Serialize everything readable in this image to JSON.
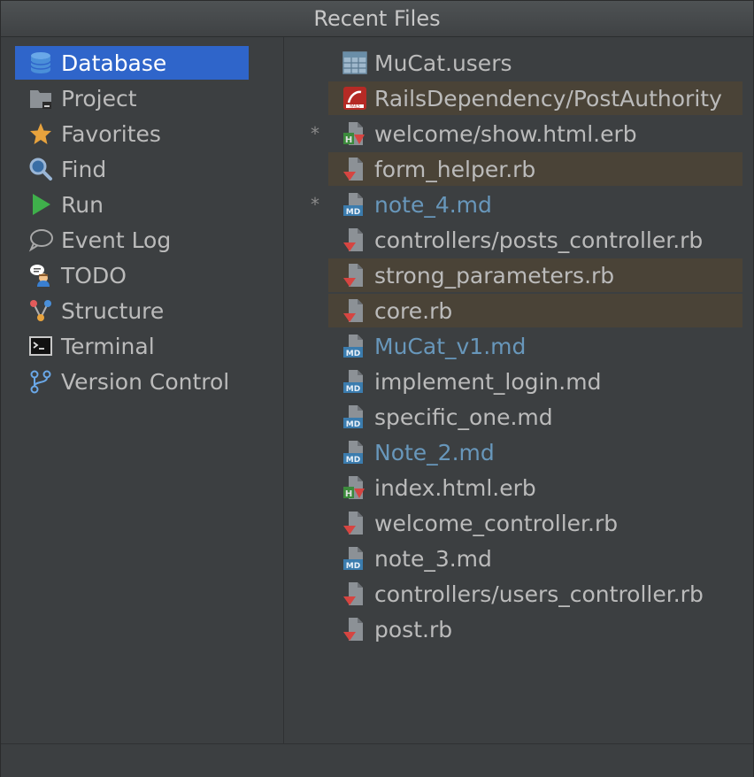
{
  "window": {
    "title": "Recent Files"
  },
  "tool_windows": [
    {
      "label": "Database",
      "icon": "database-icon",
      "selected": true
    },
    {
      "label": "Project",
      "icon": "project-folder-icon"
    },
    {
      "label": "Favorites",
      "icon": "star-icon"
    },
    {
      "label": "Find",
      "icon": "magnifier-icon"
    },
    {
      "label": "Run",
      "icon": "run-icon"
    },
    {
      "label": "Event Log",
      "icon": "speech-bubble-icon"
    },
    {
      "label": "TODO",
      "icon": "todo-icon"
    },
    {
      "label": "Structure",
      "icon": "structure-icon"
    },
    {
      "label": "Terminal",
      "icon": "terminal-icon"
    },
    {
      "label": "Version Control",
      "icon": "version-control-icon"
    }
  ],
  "recent_files": [
    {
      "label": "MuCat.users",
      "icon": "db-table-icon"
    },
    {
      "label": "RailsDependency/PostAuthority",
      "icon": "rails-icon",
      "highlighted": true
    },
    {
      "label": "welcome/show.html.erb",
      "icon": "erb-file-icon",
      "modified_marker": "*"
    },
    {
      "label": "form_helper.rb",
      "icon": "ruby-file-icon",
      "highlighted": true
    },
    {
      "label": "note_4.md",
      "icon": "markdown-file-icon",
      "modified_marker": "*",
      "blue": true
    },
    {
      "label": "controllers/posts_controller.rb",
      "icon": "ruby-file-icon"
    },
    {
      "label": "strong_parameters.rb",
      "icon": "ruby-file-icon",
      "highlighted": true
    },
    {
      "label": "core.rb",
      "icon": "ruby-file-icon",
      "highlighted": true
    },
    {
      "label": "MuCat_v1.md",
      "icon": "markdown-file-icon",
      "blue": true
    },
    {
      "label": "implement_login.md",
      "icon": "markdown-file-icon"
    },
    {
      "label": "specific_one.md",
      "icon": "markdown-file-icon"
    },
    {
      "label": "Note_2.md",
      "icon": "markdown-file-icon",
      "blue": true
    },
    {
      "label": "index.html.erb",
      "icon": "erb-file-icon"
    },
    {
      "label": "welcome_controller.rb",
      "icon": "ruby-file-icon"
    },
    {
      "label": "note_3.md",
      "icon": "markdown-file-icon"
    },
    {
      "label": "controllers/users_controller.rb",
      "icon": "ruby-file-icon"
    },
    {
      "label": "post.rb",
      "icon": "ruby-file-icon"
    }
  ],
  "colors": {
    "background": "#3c3f41",
    "selection": "#2f65ca",
    "highlight_row": "#4a4337",
    "text": "#bbbbbb",
    "modified_blue": "#6897bb",
    "ruby_red": "#d64541"
  }
}
